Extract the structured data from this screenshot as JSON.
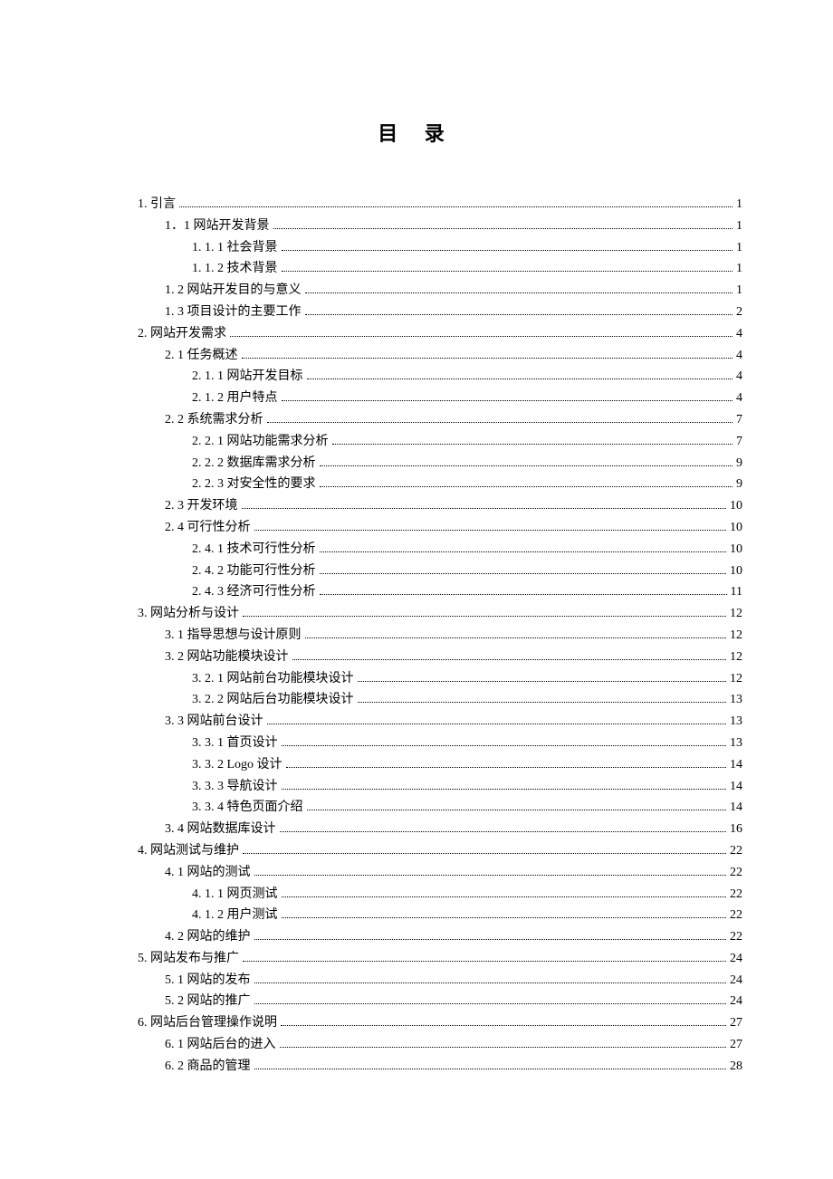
{
  "title": "目 录",
  "entries": [
    {
      "level": 0,
      "label": "1. 引言",
      "page": "1"
    },
    {
      "level": 1,
      "label": "1．1 网站开发背景",
      "page": "1"
    },
    {
      "level": 2,
      "label": "1. 1. 1 社会背景",
      "page": "1"
    },
    {
      "level": 2,
      "label": "1. 1. 2 技术背景",
      "page": "1"
    },
    {
      "level": 1,
      "label": "1. 2 网站开发目的与意义",
      "page": "1"
    },
    {
      "level": 1,
      "label": "1. 3 项目设计的主要工作",
      "page": "2"
    },
    {
      "level": 0,
      "label": "2. 网站开发需求",
      "page": "4"
    },
    {
      "level": 1,
      "label": "2. 1 任务概述",
      "page": "4"
    },
    {
      "level": 2,
      "label": "2. 1. 1 网站开发目标",
      "page": "4"
    },
    {
      "level": 2,
      "label": "2. 1. 2 用户特点",
      "page": "4"
    },
    {
      "level": 1,
      "label": "2. 2 系统需求分析",
      "page": "7"
    },
    {
      "level": 2,
      "label": "2. 2. 1 网站功能需求分析",
      "page": "7"
    },
    {
      "level": 2,
      "label": "2. 2. 2 数据库需求分析",
      "page": "9"
    },
    {
      "level": 2,
      "label": "2. 2. 3 对安全性的要求",
      "page": "9"
    },
    {
      "level": 1,
      "label": "2. 3 开发环境",
      "page": "10"
    },
    {
      "level": 1,
      "label": "2. 4 可行性分析",
      "page": "10"
    },
    {
      "level": 2,
      "label": "2. 4. 1 技术可行性分析",
      "page": "10"
    },
    {
      "level": 2,
      "label": "2. 4. 2 功能可行性分析",
      "page": "10"
    },
    {
      "level": 2,
      "label": "2. 4. 3 经济可行性分析",
      "page": "11"
    },
    {
      "level": 0,
      "label": "3. 网站分析与设计",
      "page": "12"
    },
    {
      "level": 1,
      "label": "3. 1 指导思想与设计原则",
      "page": "12"
    },
    {
      "level": 1,
      "label": "3. 2 网站功能模块设计",
      "page": "12"
    },
    {
      "level": 2,
      "label": "3. 2. 1 网站前台功能模块设计",
      "page": "12"
    },
    {
      "level": 2,
      "label": "3. 2. 2 网站后台功能模块设计",
      "page": "13"
    },
    {
      "level": 1,
      "label": "3. 3 网站前台设计",
      "page": "13"
    },
    {
      "level": 2,
      "label": "3. 3. 1 首页设计",
      "page": "13"
    },
    {
      "level": 2,
      "label": "3. 3. 2  Logo 设计",
      "page": "14"
    },
    {
      "level": 2,
      "label": "3. 3. 3  导航设计",
      "page": "14"
    },
    {
      "level": 2,
      "label": "3. 3. 4 特色页面介绍",
      "page": "14"
    },
    {
      "level": 1,
      "label": "3. 4 网站数据库设计",
      "page": "16"
    },
    {
      "level": 0,
      "label": "4. 网站测试与维护",
      "page": "22"
    },
    {
      "level": 1,
      "label": "4. 1 网站的测试",
      "page": "22"
    },
    {
      "level": 2,
      "label": "4. 1. 1 网页测试",
      "page": "22"
    },
    {
      "level": 2,
      "label": "4. 1. 2 用户测试",
      "page": "22"
    },
    {
      "level": 1,
      "label": "4. 2 网站的维护",
      "page": "22"
    },
    {
      "level": 0,
      "label": "5. 网站发布与推广",
      "page": "24"
    },
    {
      "level": 1,
      "label": "5. 1 网站的发布",
      "page": "24"
    },
    {
      "level": 1,
      "label": "5. 2 网站的推广",
      "page": " 24"
    },
    {
      "level": 0,
      "label": "6.  网站后台管理操作说明",
      "page": "27"
    },
    {
      "level": 1,
      "label": "6. 1 网站后台的进入",
      "page": "27"
    },
    {
      "level": 1,
      "label": "6. 2 商品的管理",
      "page": "28"
    }
  ]
}
